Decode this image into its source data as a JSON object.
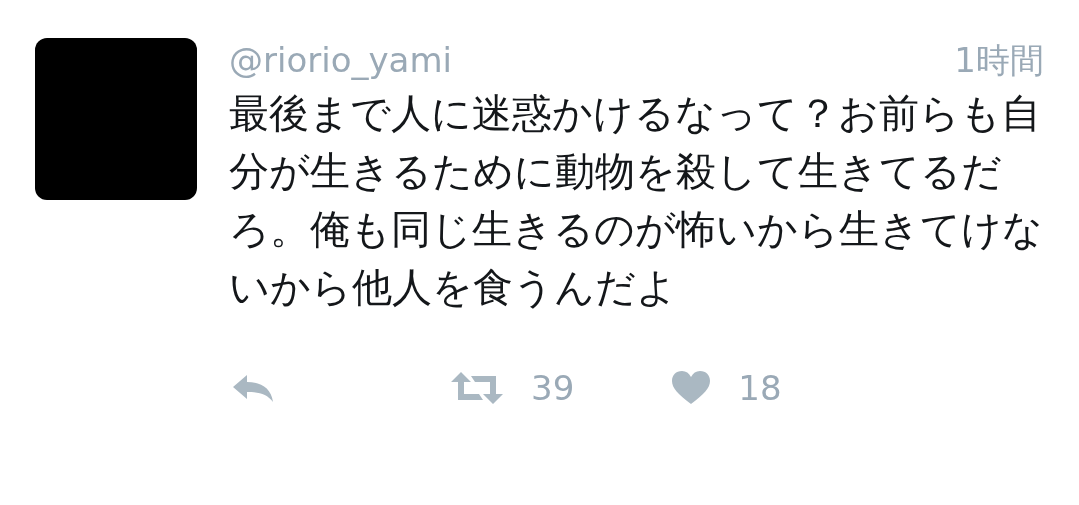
{
  "tweet": {
    "username": "@riorio_yami",
    "time": "1時間",
    "text": "最後まで人に迷惑かけるなって？お前らも自分が生きるために動物を殺して生きてるだろ。俺も同じ生きるのが怖いから生きてけないから他人を食うんだよ",
    "retweet_count": "39",
    "like_count": "18"
  }
}
